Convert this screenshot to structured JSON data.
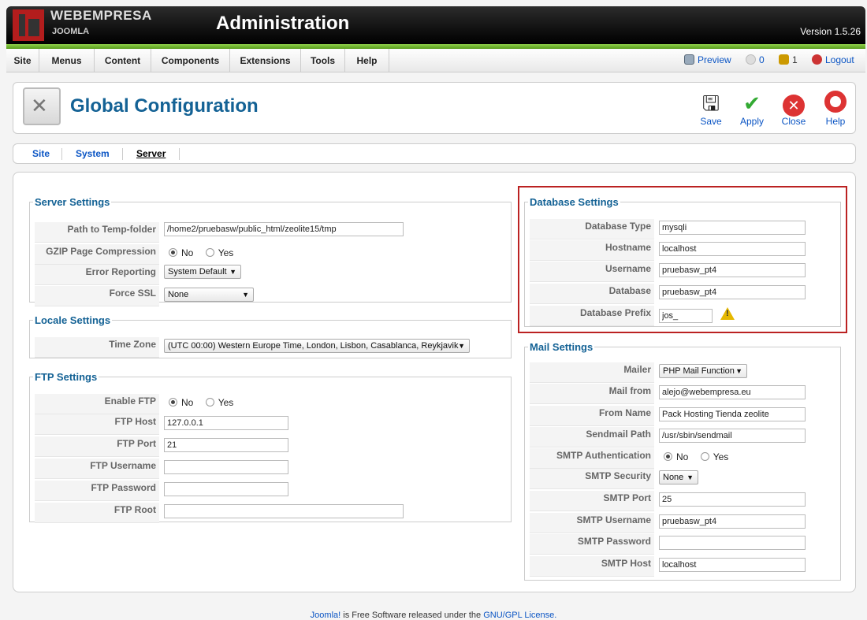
{
  "header": {
    "brand_top": "WEBEMPRESA",
    "brand_bottom": "JOOMLA",
    "title": "Administration",
    "version": "Version 1.5.26"
  },
  "menu": {
    "items": [
      "Site",
      "Menus",
      "Content",
      "Components",
      "Extensions",
      "Tools",
      "Help"
    ],
    "preview": "Preview",
    "messages_count": "0",
    "users_count": "1",
    "logout": "Logout"
  },
  "toolbar": {
    "title": "Global Configuration",
    "save": "Save",
    "apply": "Apply",
    "close": "Close",
    "help": "Help"
  },
  "tabs": [
    "Site",
    "System",
    "Server"
  ],
  "server": {
    "legend": "Server Settings",
    "temp_label": "Path to Temp-folder",
    "temp_value": "/home2/pruebasw/public_html/zeolite15/tmp",
    "gzip_label": "GZIP Page Compression",
    "error_label": "Error Reporting",
    "error_value": "System Default",
    "ssl_label": "Force SSL",
    "ssl_value": "None",
    "no": "No",
    "yes": "Yes"
  },
  "locale": {
    "legend": "Locale Settings",
    "tz_label": "Time Zone",
    "tz_value": "(UTC 00:00) Western Europe Time, London, Lisbon, Casablanca, Reykjavik"
  },
  "ftp": {
    "legend": "FTP Settings",
    "enable_label": "Enable FTP",
    "host_label": "FTP Host",
    "host_value": "127.0.0.1",
    "port_label": "FTP Port",
    "port_value": "21",
    "user_label": "FTP Username",
    "pass_label": "FTP Password",
    "root_label": "FTP Root"
  },
  "database": {
    "legend": "Database Settings",
    "type_label": "Database Type",
    "type_value": "mysqli",
    "host_label": "Hostname",
    "host_value": "localhost",
    "user_label": "Username",
    "user_value": "pruebasw_pt4",
    "db_label": "Database",
    "db_value": "pruebasw_pt4",
    "prefix_label": "Database Prefix",
    "prefix_value": "jos_"
  },
  "mail": {
    "legend": "Mail Settings",
    "mailer_label": "Mailer",
    "mailer_value": "PHP Mail Function",
    "from_label": "Mail from",
    "from_value": "alejo@webempresa.eu",
    "fromname_label": "From Name",
    "fromname_value": "Pack Hosting Tienda zeolite",
    "sendmail_label": "Sendmail Path",
    "sendmail_value": "/usr/sbin/sendmail",
    "smtpauth_label": "SMTP Authentication",
    "smtpsec_label": "SMTP Security",
    "smtpsec_value": "None",
    "smtpport_label": "SMTP Port",
    "smtpport_value": "25",
    "smtpuser_label": "SMTP Username",
    "smtpuser_value": "pruebasw_pt4",
    "smtppass_label": "SMTP Password",
    "smtphost_label": "SMTP Host",
    "smtphost_value": "localhost"
  },
  "footer": {
    "pre": "Joomla!",
    "mid": " is Free Software released under the ",
    "link": "GNU/GPL License."
  }
}
